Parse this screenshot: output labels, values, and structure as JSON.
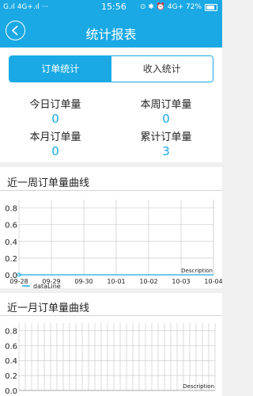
{
  "status_bar": {
    "left": "G.ıl 4G+.ıl ···",
    "time": "15:56",
    "right": "⊙ ✱ ⏰ 4G+ 72%"
  },
  "header": {
    "title": "统计报表"
  },
  "tabs": [
    {
      "label": "订单统计",
      "active": true
    },
    {
      "label": "收入统计",
      "active": false
    }
  ],
  "stats": {
    "today": {
      "label": "今日订单量",
      "value": "0"
    },
    "week": {
      "label": "本周订单量",
      "value": "0"
    },
    "month": {
      "label": "本月订单量",
      "value": "0"
    },
    "total": {
      "label": "累计订单量",
      "value": "3"
    }
  },
  "weekly_title": "近一周订单量曲线",
  "monthly_title": "近一月订单量曲线",
  "colors": {
    "accent": "#1aa9e4",
    "grid": "#cccccc"
  },
  "chart_data": [
    {
      "type": "line",
      "title": "",
      "description": "Description",
      "categories": [
        "09-28",
        "09-29",
        "09-30",
        "10-01",
        "10-02",
        "10-03",
        "10-04"
      ],
      "series": [
        {
          "name": "dataLine",
          "values": [
            0,
            0,
            0,
            0,
            0,
            0,
            0
          ]
        }
      ],
      "yticks": [
        "0.0",
        "0.2",
        "0.4",
        "0.6",
        "0.8"
      ],
      "ylim": [
        0,
        0.9
      ],
      "grid": true,
      "legend": "bottom-left"
    },
    {
      "type": "line",
      "title": "",
      "description": "Description",
      "categories": [],
      "series": [],
      "yticks": [
        "0.0",
        "0.2",
        "0.4",
        "0.6",
        "0.8"
      ],
      "ylim": [
        0,
        0.9
      ],
      "grid": true,
      "legend": "bottom-left"
    }
  ]
}
